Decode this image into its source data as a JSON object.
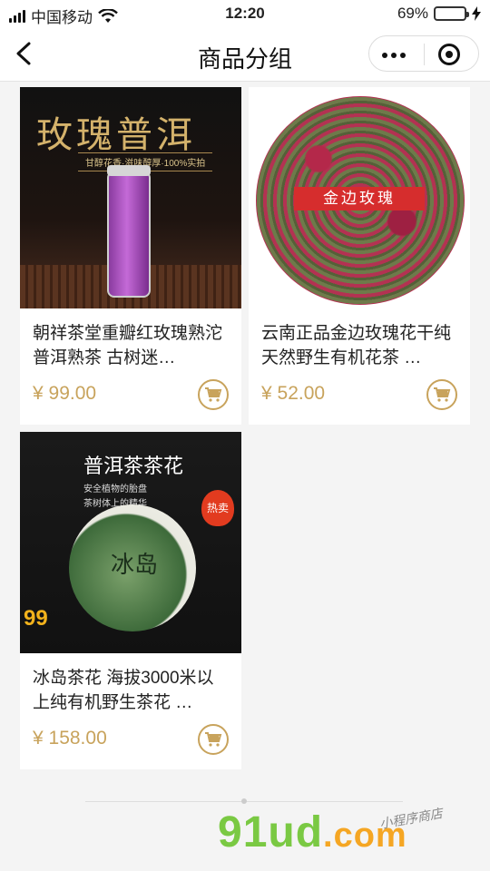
{
  "status": {
    "carrier": "中国移动",
    "time": "12:20",
    "battery": "69%",
    "battery_level": 0.69
  },
  "nav": {
    "title": "商品分组"
  },
  "products": [
    {
      "name": "朝祥茶堂重瓣红玫瑰熟沱 普洱熟茶 古树迷…",
      "price": "¥ 99.00",
      "image": {
        "title": "玫瑰普洱",
        "tagline": "甘醇花香·滋味醇厚·100%实拍"
      }
    },
    {
      "name": "云南正品金边玫瑰花干纯天然野生有机花茶 …",
      "price": "¥ 52.00",
      "image": {
        "banner": "金边玫瑰"
      }
    },
    {
      "name": "冰岛茶花  海拔3000米以上纯有机野生茶花 …",
      "price": "¥ 158.00",
      "image": {
        "title": "普洱茶茶花",
        "line1": "安全植物的胎盘",
        "line2": "茶树体上的精华",
        "cake_text": "冰岛",
        "hot": "热卖",
        "sale": "99"
      }
    }
  ],
  "watermark": {
    "brand": "91ud",
    "domain": ".com",
    "sub": "小程序商店"
  },
  "colors": {
    "price": "#c8a35c",
    "accent": "#f5c000"
  }
}
